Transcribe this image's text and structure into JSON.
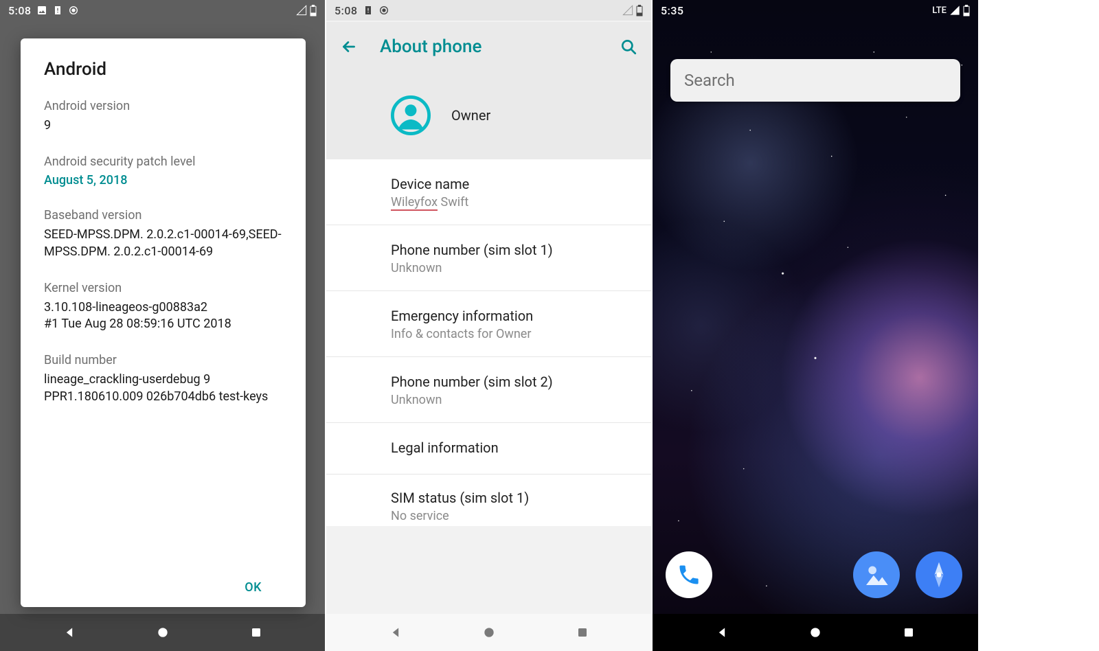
{
  "screen1": {
    "status": {
      "clock": "5:08"
    },
    "dialog": {
      "title": "Android",
      "version_label": "Android version",
      "version_value": "9",
      "patch_label": "Android security patch level",
      "patch_value": "August 5, 2018",
      "baseband_label": "Baseband version",
      "baseband_value": "SEED-MPSS.DPM. 2.0.2.c1-00014-69,SEED-MPSS.DPM. 2.0.2.c1-00014-69",
      "kernel_label": "Kernel version",
      "kernel_value": "3.10.108-lineageos-g00883a2\n#1 Tue Aug 28 08:59:16 UTC 2018",
      "build_label": "Build number",
      "build_value": "lineage_crackling-userdebug 9 PPR1.180610.009 026b704db6 test-keys",
      "ok": "OK"
    }
  },
  "screen2": {
    "status": {
      "clock": "5:08"
    },
    "header_title": "About phone",
    "owner_label": "Owner",
    "items": {
      "device_title": "Device name",
      "device_sub_brand": "Wileyfox",
      "device_sub_model": " Swift",
      "phone1_title": "Phone number (sim slot 1)",
      "phone1_sub": "Unknown",
      "emerg_title": "Emergency information",
      "emerg_sub": "Info & contacts for Owner",
      "phone2_title": "Phone number (sim slot 2)",
      "phone2_sub": "Unknown",
      "legal_title": "Legal information",
      "sim1_title": "SIM status (sim slot 1)",
      "sim1_sub": "No service"
    }
  },
  "screen3": {
    "status": {
      "clock": "5:35",
      "network": "LTE"
    },
    "search_placeholder": "Search"
  }
}
